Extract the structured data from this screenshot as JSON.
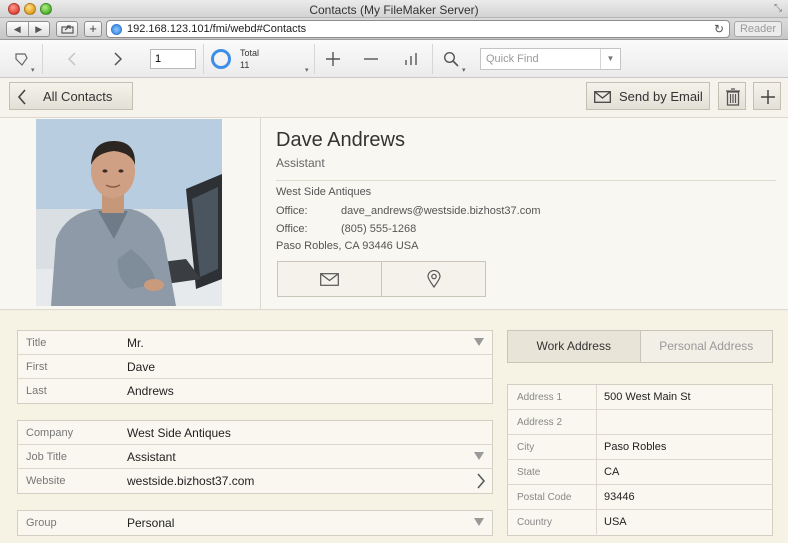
{
  "window": {
    "title": "Contacts (My FileMaker Server)",
    "url": "192.168.123.101/fmi/webd#Contacts",
    "reader_label": "Reader"
  },
  "toolbar": {
    "record_number": "1",
    "total_label": "Total",
    "total_count": "11",
    "quick_find_placeholder": "Quick Find",
    "accent_color": "#3e8ee8"
  },
  "header": {
    "back_label": "All Contacts",
    "send_email_label": "Send by Email"
  },
  "contact": {
    "name": "Dave Andrews",
    "title": "Assistant",
    "company": "West Side Antiques",
    "email_label": "Office:",
    "email": "dave_andrews@westside.bizhost37.com",
    "phone_label": "Office:",
    "phone": "(805) 555-1268",
    "city_line": "Paso Robles, CA 93446 USA"
  },
  "form": {
    "name_group": [
      {
        "label": "Title",
        "value": "Mr.",
        "control": "menu"
      },
      {
        "label": "First",
        "value": "Dave",
        "control": "none"
      },
      {
        "label": "Last",
        "value": "Andrews",
        "control": "none"
      }
    ],
    "work_group": [
      {
        "label": "Company",
        "value": "West Side Antiques",
        "control": "none"
      },
      {
        "label": "Job Title",
        "value": "Assistant",
        "control": "menu"
      },
      {
        "label": "Website",
        "value": "westside.bizhost37.com",
        "control": "arrow"
      }
    ],
    "misc_group": [
      {
        "label": "Group",
        "value": "Personal",
        "control": "menu"
      }
    ]
  },
  "address_tabs": {
    "active": "Work Address",
    "inactive": "Personal Address"
  },
  "address": [
    {
      "label": "Address 1",
      "value": "500 West Main St"
    },
    {
      "label": "Address 2",
      "value": ""
    },
    {
      "label": "City",
      "value": "Paso Robles"
    },
    {
      "label": "State",
      "value": "CA"
    },
    {
      "label": "Postal Code",
      "value": "93446"
    },
    {
      "label": "Country",
      "value": "USA"
    }
  ]
}
